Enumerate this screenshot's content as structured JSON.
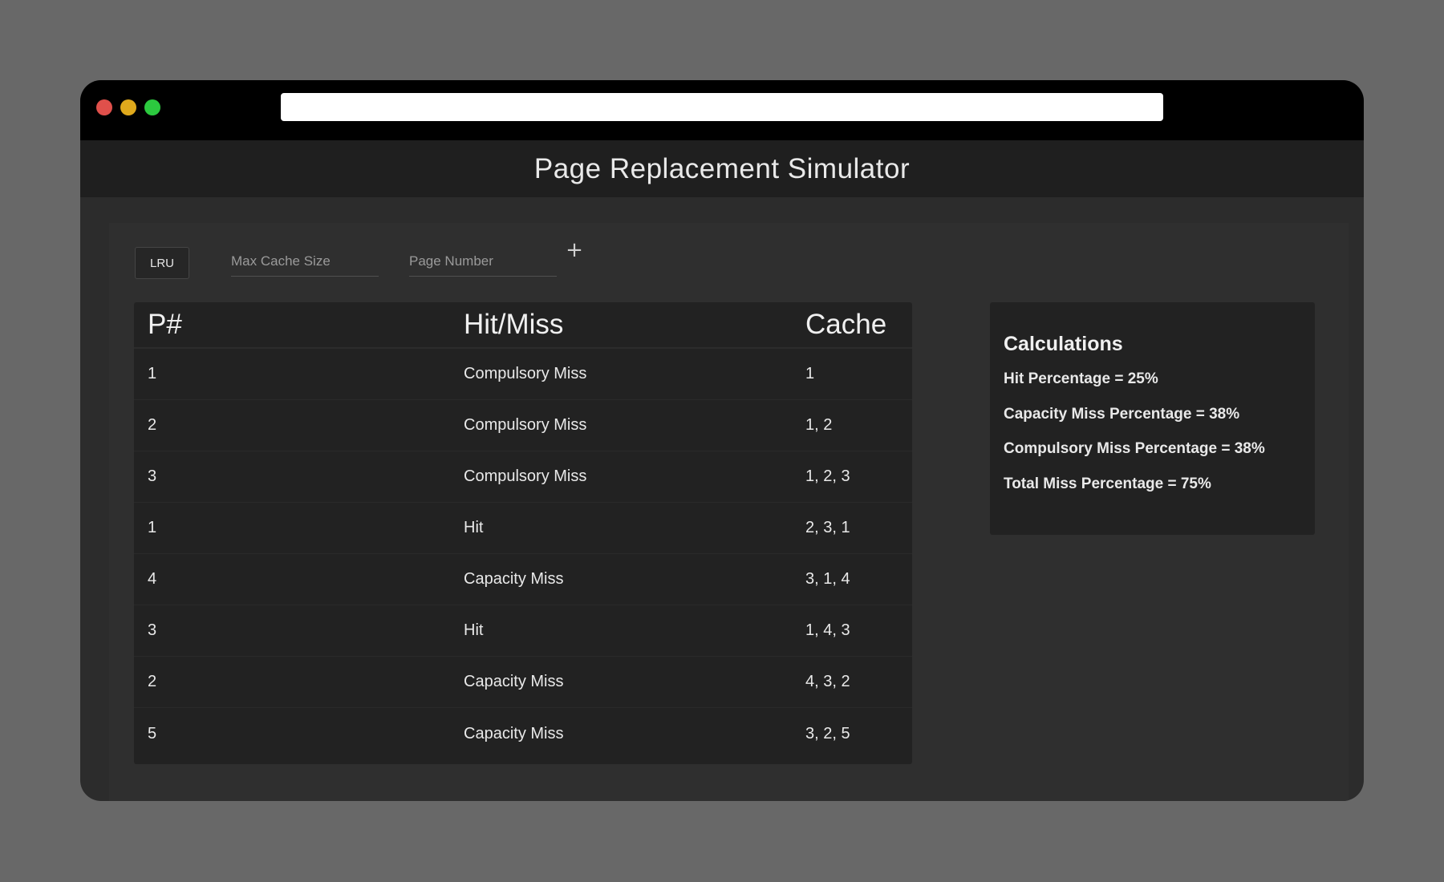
{
  "window": {
    "title": "Page Replacement Simulator"
  },
  "controls": {
    "algorithm": "LRU",
    "cache_size_placeholder": "Max Cache Size",
    "page_number_placeholder": "Page Number",
    "add_icon": "+"
  },
  "table": {
    "headers": [
      "P#",
      "Hit/Miss",
      "Cache"
    ],
    "rows": [
      {
        "page": "1",
        "result": "Compulsory Miss",
        "cache": "1"
      },
      {
        "page": "2",
        "result": "Compulsory Miss",
        "cache": "1, 2"
      },
      {
        "page": "3",
        "result": "Compulsory Miss",
        "cache": "1, 2, 3"
      },
      {
        "page": "1",
        "result": "Hit",
        "cache": "2, 3, 1"
      },
      {
        "page": "4",
        "result": "Capacity Miss",
        "cache": "3, 1, 4"
      },
      {
        "page": "3",
        "result": "Hit",
        "cache": "1, 4, 3"
      },
      {
        "page": "2",
        "result": "Capacity Miss",
        "cache": "4, 3, 2"
      },
      {
        "page": "5",
        "result": "Capacity Miss",
        "cache": "3, 2, 5"
      }
    ]
  },
  "calculations": {
    "title": "Calculations",
    "lines": [
      "Hit Percentage = 25%",
      "Capacity Miss Percentage = 38%",
      "Compulsory Miss Percentage = 38%",
      "Total Miss Percentage = 75%"
    ]
  },
  "colors": {
    "page_background": "#686868",
    "titlebar": "#000000",
    "header": "#1f1f1f",
    "panel": "#2f2f2f",
    "card": "#222222",
    "close": "#e0504b",
    "minimize": "#dfa91c",
    "maximize": "#2cc93f"
  }
}
